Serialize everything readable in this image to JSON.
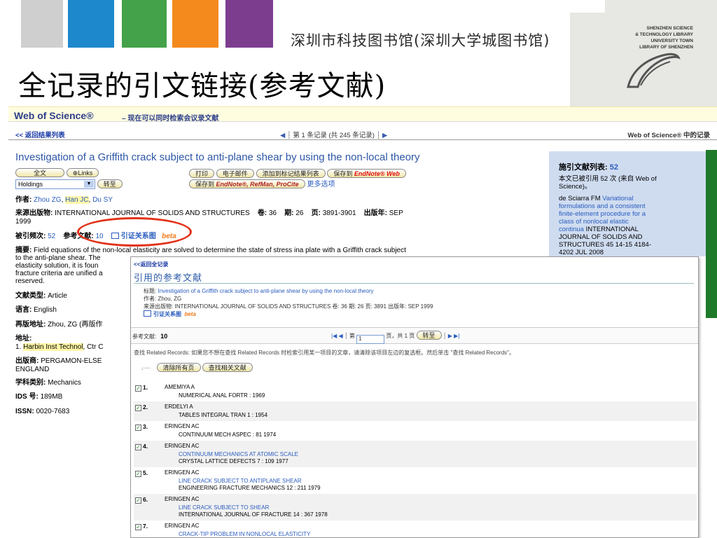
{
  "slide": {
    "library_name": "深圳市科技图书馆(深圳大学城图书馆)",
    "logo_lines": [
      "SHENZHEN SCIENCE",
      "& TECHNOLOGY LIBRARY",
      "UNIVERSITY TOWN",
      "LIBRARY OF SHENZHEN"
    ],
    "title": "全记录的引文链接(参考文献)"
  },
  "wos": {
    "brand": "Web of Science®",
    "tagline": "– 现在可以同时检索会议录文献",
    "back_label": "<< 返回结果列表",
    "pager": {
      "prev": "◀",
      "text": "第 1 条记录 (共 245 条记录)",
      "next": "▶"
    },
    "right_label": "Web of Science® 中的记录",
    "article_title": "Investigation of a Griffith crack subject to anti-plane shear by using the non-local theory",
    "buttons": {
      "fulltext": "全文",
      "links": "⊕Links",
      "holdings": "Holdings",
      "goto": "转至",
      "print": "打印",
      "email": "电子邮件",
      "add_marked": "添加到标记结果列表",
      "save_to": "保存到",
      "endnote_web": "EndNote® Web",
      "save_to2": "保存到",
      "save_targets": "EndNote®, RefMan, ProCite",
      "more_options": "更多选项"
    },
    "authors_label": "作者:",
    "authors": [
      "Zhou ZG",
      "Han JC",
      "Du SY"
    ],
    "source_label": "来源出版物:",
    "source": "INTERNATIONAL JOURNAL OF SOLIDS AND STRUCTURES",
    "volume_label": "卷:",
    "volume": "36",
    "issue_label": "期:",
    "issue": "26",
    "pages_label": "页:",
    "pages": "3891-3901",
    "pub_label": "出版年:",
    "pub_date_1": "SEP",
    "pub_date_2": "1999",
    "times_cited_label": "被引频次:",
    "times_cited": "52",
    "refs_label": "参考文献:",
    "refs": "10",
    "citation_map": "引证关系图",
    "beta": "beta",
    "abstract_label": "摘要:",
    "abstract_lines": [
      "Field equations of the non-local elasticity are solved to determine the state of stress ina plate with a Griffith crack subject",
      "to the anti-plane shear. The",
      "elasticity solution, it is foun",
      "fracture criteria are unified a",
      "reserved."
    ],
    "doc_type_label": "文献类型:",
    "doc_type": "Article",
    "lang_label": "语言:",
    "lang": "English",
    "reprint_label": "再版地址:",
    "reprint": "Zhou, ZG (再版作",
    "address_label": "地址:",
    "address_prefix": "1.",
    "address_org": "Harbin Inst Technol",
    "address_rest": ", Ctr C",
    "publisher_label": "出版商:",
    "publisher_1": "PERGAMON-ELSE",
    "publisher_2": "ENGLAND",
    "subject_label": "学科类别:",
    "subject": "Mechanics",
    "ids_label": "IDS 号:",
    "ids": "189MB",
    "issn_label": "ISSN:",
    "issn": "0020-7683"
  },
  "sidebar": {
    "title": "施引文献列表:",
    "count": "52",
    "line1": "本文已被引用 52 次 (来自 Web of",
    "line2": "Science)。",
    "cite_author": "de Sciarra FM",
    "cite_title_lines": [
      "Variational",
      "formulations and a consistent",
      "finite-element procedure for a",
      "class of nonlocal elastic",
      "continua"
    ],
    "cite_src_lines": [
      "INTERNATIONAL",
      "JOURNAL OF SOLIDS AND",
      "STRUCTURES 45 14-15 4184-",
      "4202 JUL 2008"
    ]
  },
  "popup": {
    "back": "<<返回全记录",
    "heading": "引用的参考文献",
    "title_label": "标题:",
    "title": "Investigation of a Griffith crack subject to anti-plane shear by using the non-local theory",
    "author_label": "作者:",
    "author": "Zhou, ZG",
    "source_label": "来源出版物:",
    "source": "INTERNATIONAL JOURNAL OF SOLIDS AND STRUCTURES 卷: 36 期: 26 页: 3891 出版年: SEP 1999",
    "citation_map": "引证关系图",
    "beta": "beta",
    "count_label": "参考文献:",
    "count": "10",
    "pager_first": "|◀",
    "pager_prev": "◀",
    "page_label": "第",
    "page_value": "1",
    "page_total": "页，共 1 页",
    "goto": "转至",
    "pager_next": "▶",
    "pager_last": "▶|",
    "note": "查找 Related Records: 如果您不想在查找 Related Records 时检索引用某一项目的文章，请清除该项目左边的复选框。然后单击 \"查找 Related Records\"。",
    "clear_btn": "清除所有页",
    "find_btn": "查找相关文献",
    "refs": [
      {
        "n": "1.",
        "author": "AMEMIYA A",
        "title": "",
        "src": "NUMERICAL ANAL FORTR : 1969"
      },
      {
        "n": "2.",
        "author": "ERDELYI A",
        "title": "",
        "src": "TABLES INTEGRAL TRAN 1 : 1954"
      },
      {
        "n": "3.",
        "author": "ERINGEN AC",
        "title": "",
        "src": "CONTINUUM MECH ASPEC : 81 1974"
      },
      {
        "n": "4.",
        "author": "ERINGEN AC",
        "title": "CONTINUUM MECHANICS AT ATOMIC SCALE",
        "src": "CRYSTAL LATTICE DEFECTS 7 : 109 1977"
      },
      {
        "n": "5.",
        "author": "ERINGEN AC",
        "title": "LINE CRACK SUBJECT TO ANTIPLANE SHEAR",
        "src": "ENGINEERING FRACTURE MECHANICS 12 : 211 1979"
      },
      {
        "n": "6.",
        "author": "ERINGEN AC",
        "title": "LINE CRACK SUBJECT TO SHEAR",
        "src": "INTERNATIONAL JOURNAL OF FRACTURE 14 : 367 1978"
      },
      {
        "n": "7.",
        "author": "ERINGEN AC",
        "title": "CRACK-TIP PROBLEM IN NONLOCAL ELASTICITY",
        "src": ""
      }
    ]
  }
}
